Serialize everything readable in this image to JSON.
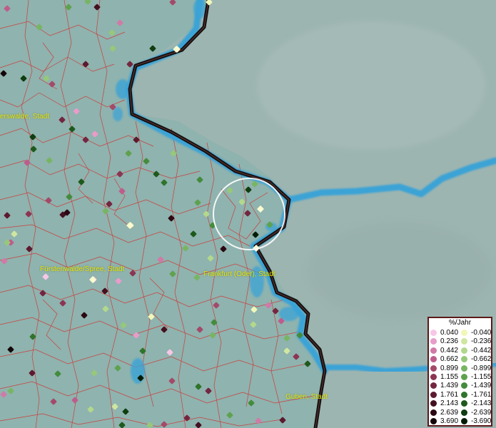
{
  "map": {
    "city_labels": [
      {
        "id": "eberswalde",
        "text": "erswalde, Stadt"
      },
      {
        "id": "fuerstenwalde",
        "text": "Fürstenwalde/Spree, Stadt"
      },
      {
        "id": "frankfurt",
        "text": "Frankfurt (Oder), Stadt"
      },
      {
        "id": "guben",
        "text": "Guben, Stadt"
      }
    ],
    "colors": {
      "background": "#8fb3ae",
      "river": "#3aa3d6",
      "border": "#141010",
      "municipal_lines": "#d42b2b",
      "label": "#e6e600"
    }
  },
  "legend": {
    "title": "%/Jahr",
    "positive": [
      {
        "value": "0.040",
        "color": "#f7c6e6"
      },
      {
        "value": "0.236",
        "color": "#e79cc9"
      },
      {
        "value": "0.442",
        "color": "#d07aa8"
      },
      {
        "value": "0.662",
        "color": "#bd5d8b"
      },
      {
        "value": "0.899",
        "color": "#a34a6a"
      },
      {
        "value": "1.155",
        "color": "#8b3553"
      },
      {
        "value": "1.439",
        "color": "#742640"
      },
      {
        "value": "1.761",
        "color": "#5c1a2f"
      },
      {
        "value": "2.143",
        "color": "#441020"
      },
      {
        "value": "2.639",
        "color": "#2c0812"
      },
      {
        "value": "3.690",
        "color": "#140307"
      }
    ],
    "negative": [
      {
        "value": "-0.040",
        "color": "#f0f7b8"
      },
      {
        "value": "-0.236",
        "color": "#cfe6a0"
      },
      {
        "value": "-0.442",
        "color": "#b2d88c"
      },
      {
        "value": "-0.662",
        "color": "#96c87a"
      },
      {
        "value": "-0.899",
        "color": "#78b563"
      },
      {
        "value": "-1.155",
        "color": "#5ea24f"
      },
      {
        "value": "-1.439",
        "color": "#448c3c"
      },
      {
        "value": "-1.761",
        "color": "#2f742b"
      },
      {
        "value": "-2.143",
        "color": "#1d5a1c"
      },
      {
        "value": "-2.639",
        "color": "#0f3d10"
      },
      {
        "value": "-3.690",
        "color": "#031c05"
      }
    ]
  }
}
